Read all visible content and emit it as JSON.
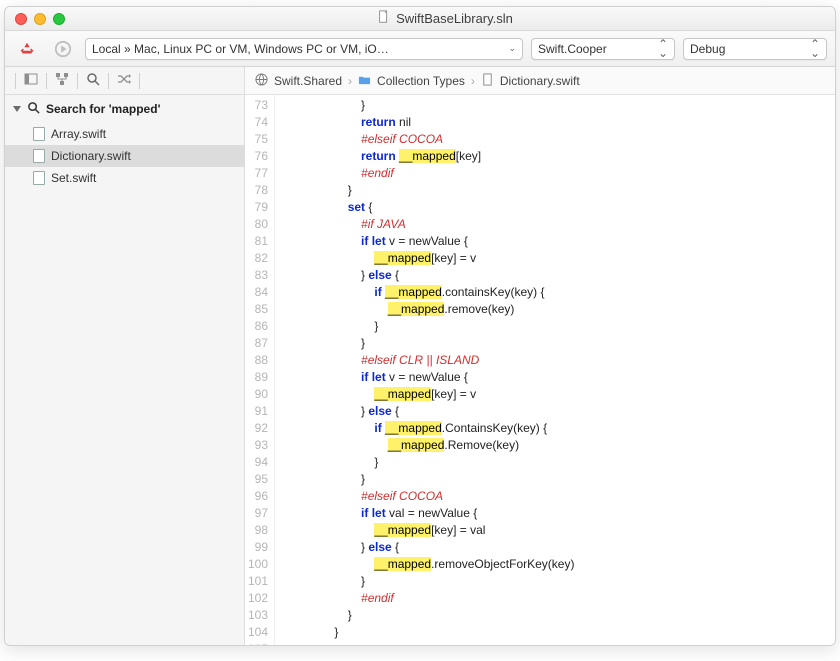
{
  "window": {
    "title": "SwiftBaseLibrary.sln"
  },
  "toolbar": {
    "target": "Local » Mac, Linux PC or VM, Windows PC or VM, iO…",
    "scheme": "Swift.Cooper",
    "config": "Debug"
  },
  "sidebar": {
    "search_label_prefix": "Search for ",
    "search_term": "'mapped'",
    "results": [
      {
        "name": "Array.swift"
      },
      {
        "name": "Dictionary.swift",
        "selected": true
      },
      {
        "name": "Set.swift"
      }
    ]
  },
  "breadcrumb": {
    "root": "Swift.Shared",
    "folder": "Collection Types",
    "file": "Dictionary.swift"
  },
  "code": {
    "first_line": 73,
    "lines": [
      [
        {
          "i": 24
        },
        {
          "t": "}"
        }
      ],
      [
        {
          "i": 24
        },
        {
          "t": "return",
          "c": "kw"
        },
        {
          "t": " nil"
        }
      ],
      [
        {
          "i": 24
        },
        {
          "t": "#elseif COCOA",
          "c": "pp"
        }
      ],
      [
        {
          "i": 24
        },
        {
          "t": "return",
          "c": "kw"
        },
        {
          "t": " "
        },
        {
          "t": "__mapped",
          "c": "hl"
        },
        {
          "t": "[key]"
        }
      ],
      [
        {
          "i": 24
        },
        {
          "t": "#endif",
          "c": "pp"
        }
      ],
      [
        {
          "i": 20
        },
        {
          "t": "}"
        }
      ],
      [
        {
          "i": 20
        },
        {
          "t": "set",
          "c": "kw"
        },
        {
          "t": " {"
        }
      ],
      [
        {
          "i": 24
        },
        {
          "t": "#if JAVA",
          "c": "pp"
        }
      ],
      [
        {
          "i": 24
        },
        {
          "t": "if",
          "c": "kw"
        },
        {
          "t": " "
        },
        {
          "t": "let",
          "c": "kw"
        },
        {
          "t": " v = newValue {"
        }
      ],
      [
        {
          "i": 28
        },
        {
          "t": "__mapped",
          "c": "hl"
        },
        {
          "t": "[key] = v"
        }
      ],
      [
        {
          "i": 24
        },
        {
          "t": "} "
        },
        {
          "t": "else",
          "c": "kw"
        },
        {
          "t": " {"
        }
      ],
      [
        {
          "i": 28
        },
        {
          "t": "if",
          "c": "kw"
        },
        {
          "t": " "
        },
        {
          "t": "__mapped",
          "c": "hl"
        },
        {
          "t": ".containsKey(key) {"
        }
      ],
      [
        {
          "i": 32
        },
        {
          "t": "__mapped",
          "c": "hl"
        },
        {
          "t": ".remove(key)"
        }
      ],
      [
        {
          "i": 28
        },
        {
          "t": "}"
        }
      ],
      [
        {
          "i": 24
        },
        {
          "t": "}"
        }
      ],
      [
        {
          "i": 24
        },
        {
          "t": "#elseif CLR || ISLAND",
          "c": "pp"
        }
      ],
      [
        {
          "i": 24
        },
        {
          "t": "if",
          "c": "kw"
        },
        {
          "t": " "
        },
        {
          "t": "let",
          "c": "kw"
        },
        {
          "t": " v = newValue {"
        }
      ],
      [
        {
          "i": 28
        },
        {
          "t": "__mapped",
          "c": "hl"
        },
        {
          "t": "[key] = v"
        }
      ],
      [
        {
          "i": 24
        },
        {
          "t": "} "
        },
        {
          "t": "else",
          "c": "kw"
        },
        {
          "t": " {"
        }
      ],
      [
        {
          "i": 28
        },
        {
          "t": "if",
          "c": "kw"
        },
        {
          "t": " "
        },
        {
          "t": "__mapped",
          "c": "hl"
        },
        {
          "t": ".ContainsKey(key) {"
        }
      ],
      [
        {
          "i": 32
        },
        {
          "t": "__mapped",
          "c": "hl"
        },
        {
          "t": ".Remove(key)"
        }
      ],
      [
        {
          "i": 28
        },
        {
          "t": "}"
        }
      ],
      [
        {
          "i": 24
        },
        {
          "t": "}"
        }
      ],
      [
        {
          "i": 24
        },
        {
          "t": "#elseif COCOA",
          "c": "pp"
        }
      ],
      [
        {
          "i": 24
        },
        {
          "t": "if",
          "c": "kw"
        },
        {
          "t": " "
        },
        {
          "t": "let",
          "c": "kw"
        },
        {
          "t": " val = newValue {"
        }
      ],
      [
        {
          "i": 28
        },
        {
          "t": "__mapped",
          "c": "hl"
        },
        {
          "t": "[key] = val"
        }
      ],
      [
        {
          "i": 24
        },
        {
          "t": "} "
        },
        {
          "t": "else",
          "c": "kw"
        },
        {
          "t": " {"
        }
      ],
      [
        {
          "i": 28
        },
        {
          "t": "__mapped",
          "c": "hl"
        },
        {
          "t": ".removeObjectForKey(key)"
        }
      ],
      [
        {
          "i": 24
        },
        {
          "t": "}"
        }
      ],
      [
        {
          "i": 24
        },
        {
          "t": "#endif",
          "c": "pp"
        }
      ],
      [
        {
          "i": 20
        },
        {
          "t": "}"
        }
      ],
      [
        {
          "i": 16
        },
        {
          "t": "}"
        }
      ],
      []
    ]
  }
}
